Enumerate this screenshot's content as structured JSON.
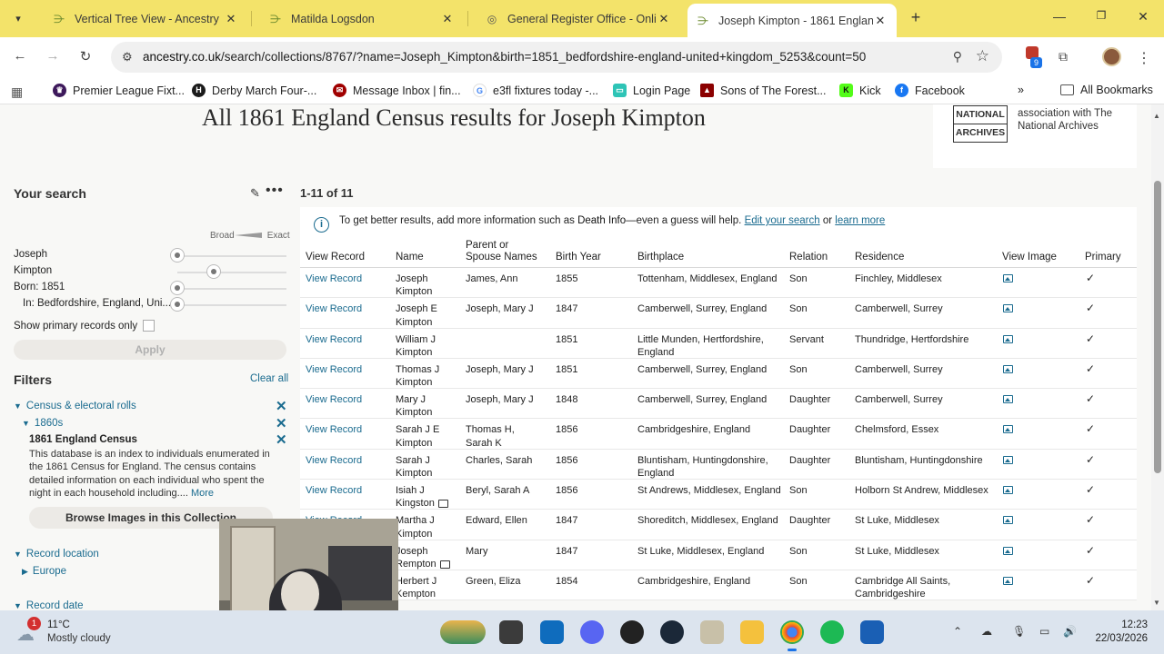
{
  "browser": {
    "tabs": [
      {
        "title": "Vertical Tree View - Ancestry",
        "active": false
      },
      {
        "title": "Matilda Logsdon",
        "active": false
      },
      {
        "title": "General Register Office - Onlin",
        "active": false
      },
      {
        "title": "Joseph Kimpton - 1861 Englanc",
        "active": true
      }
    ],
    "url_host": "ancestry.co.uk",
    "url_path": "/search/collections/8767/?name=Joseph_Kimpton&birth=1851_bedfordshire-england-united+kingdom_5253&count=50",
    "extension_badge": "9",
    "bookmarks": [
      {
        "label": "Premier League Fixt...",
        "icon": "premier-league-icon",
        "color": "#3d195b"
      },
      {
        "label": "Derby March Four-...",
        "icon": "letter-h-icon",
        "color": "#1b1b1b"
      },
      {
        "label": "Message Inbox | fin...",
        "icon": "message-icon",
        "color": "#a00000"
      },
      {
        "label": "e3fl fixtures today -...",
        "icon": "google-icon",
        "color": "#4285f4"
      },
      {
        "label": "Login Page",
        "icon": "login-icon",
        "color": "#2ec4b6"
      },
      {
        "label": "Sons of The Forest...",
        "icon": "forest-icon",
        "color": "#8b0000"
      },
      {
        "label": "Kick",
        "icon": "kick-icon",
        "color": "#53fc18"
      },
      {
        "label": "Facebook",
        "icon": "facebook-icon",
        "color": "#1877f2"
      }
    ],
    "all_bookmarks": "All Bookmarks"
  },
  "page": {
    "title": "All 1861 England Census results for Joseph Kimpton",
    "national_archives": {
      "logo_line1": "NATIONAL",
      "logo_line2": "ARCHIVES",
      "text": "association with The National Archives"
    }
  },
  "sidebar": {
    "your_search": "Your search",
    "broad": "Broad",
    "exact": "Exact",
    "first_name": "Joseph",
    "last_name": "Kimpton",
    "born": "Born: 1851",
    "born_in": "In: Bedfordshire, England, Uni...",
    "show_primary": "Show primary records only",
    "apply": "Apply",
    "filters": "Filters",
    "clear_all": "Clear all",
    "filter_category": "Census & electoral rolls",
    "filter_decade": "1860s",
    "collection_title": "1861 England Census",
    "collection_desc": "This database is an index to individuals enumerated in the 1861 Census for England. The census contains detailed information on each individual who spent the night in each household including....",
    "more": "More",
    "browse": "Browse Images in this Collection",
    "record_location": "Record location",
    "europe": "Europe",
    "record_date": "Record date"
  },
  "results": {
    "count": "1-11 of 11",
    "info_prefix": "To get better results, add more information such as ",
    "info_bold": "Death Info",
    "info_mid": "—even a guess will help. ",
    "info_link1": "Edit your search",
    "info_or": " or ",
    "info_link2": "learn more",
    "columns": [
      "View Record",
      "Name",
      "Parent or Spouse Names",
      "Birth Year",
      "Birthplace",
      "Relation",
      "Residence",
      "View Image",
      "Primary"
    ],
    "rows": [
      {
        "view": "View Record",
        "name": "Joseph Kimpton",
        "parents": "James, Ann",
        "year": "1855",
        "birthplace": "Tottenham, Middlesex, England",
        "relation": "Son",
        "residence": "Finchley, Middlesex"
      },
      {
        "view": "View Record",
        "name": "Joseph E Kimpton",
        "parents": "Joseph, Mary J",
        "year": "1847",
        "birthplace": "Camberwell, Surrey, England",
        "relation": "Son",
        "residence": "Camberwell, Surrey"
      },
      {
        "view": "View Record",
        "name": "William J Kimpton",
        "parents": "",
        "year": "1851",
        "birthplace": "Little Munden, Hertfordshire, England",
        "relation": "Servant",
        "residence": "Thundridge, Hertfordshire"
      },
      {
        "view": "View Record",
        "name": "Thomas J Kimpton",
        "parents": "Joseph, Mary J",
        "year": "1851",
        "birthplace": "Camberwell, Surrey, England",
        "relation": "Son",
        "residence": "Camberwell, Surrey"
      },
      {
        "view": "View Record",
        "name": "Mary J Kimpton",
        "parents": "Joseph, Mary J",
        "year": "1848",
        "birthplace": "Camberwell, Surrey, England",
        "relation": "Daughter",
        "residence": "Camberwell, Surrey"
      },
      {
        "view": "View Record",
        "name": "Sarah J E Kimpton",
        "parents": "Thomas H, Sarah K",
        "year": "1856",
        "birthplace": "Cambridgeshire, England",
        "relation": "Daughter",
        "residence": "Chelmsford, Essex"
      },
      {
        "view": "View Record",
        "name": "Sarah J Kimpton",
        "parents": "Charles, Sarah",
        "year": "1856",
        "birthplace": "Bluntisham, Huntingdonshire, England",
        "relation": "Daughter",
        "residence": "Bluntisham, Huntingdonshire"
      },
      {
        "view": "View Record",
        "name": "Isiah J Kingston",
        "parents": "Beryl, Sarah A",
        "year": "1856",
        "birthplace": "St Andrews, Middlesex, England",
        "relation": "Son",
        "residence": "Holborn St Andrew, Middlesex"
      },
      {
        "view": "View Record",
        "name": "Martha J Kimpton",
        "parents": "Edward, Ellen",
        "year": "1847",
        "birthplace": "Shoreditch, Middlesex, England",
        "relation": "Daughter",
        "residence": "St Luke, Middlesex"
      },
      {
        "view": "View Record",
        "name": "Joseph Rempton",
        "parents": "Mary",
        "year": "1847",
        "birthplace": "St Luke, Middlesex, England",
        "relation": "Son",
        "residence": "St Luke, Middlesex"
      },
      {
        "view": "View Record",
        "name": "Herbert J Kempton",
        "parents": "Green, Eliza",
        "year": "1854",
        "birthplace": "Cambridgeshire, England",
        "relation": "Son",
        "residence": "Cambridge All Saints, Cambridgeshire"
      }
    ]
  },
  "taskbar": {
    "weather_badge": "1",
    "temp": "11°C",
    "weather": "Mostly cloudy",
    "time": "12:23",
    "date": "22/03/2026"
  }
}
